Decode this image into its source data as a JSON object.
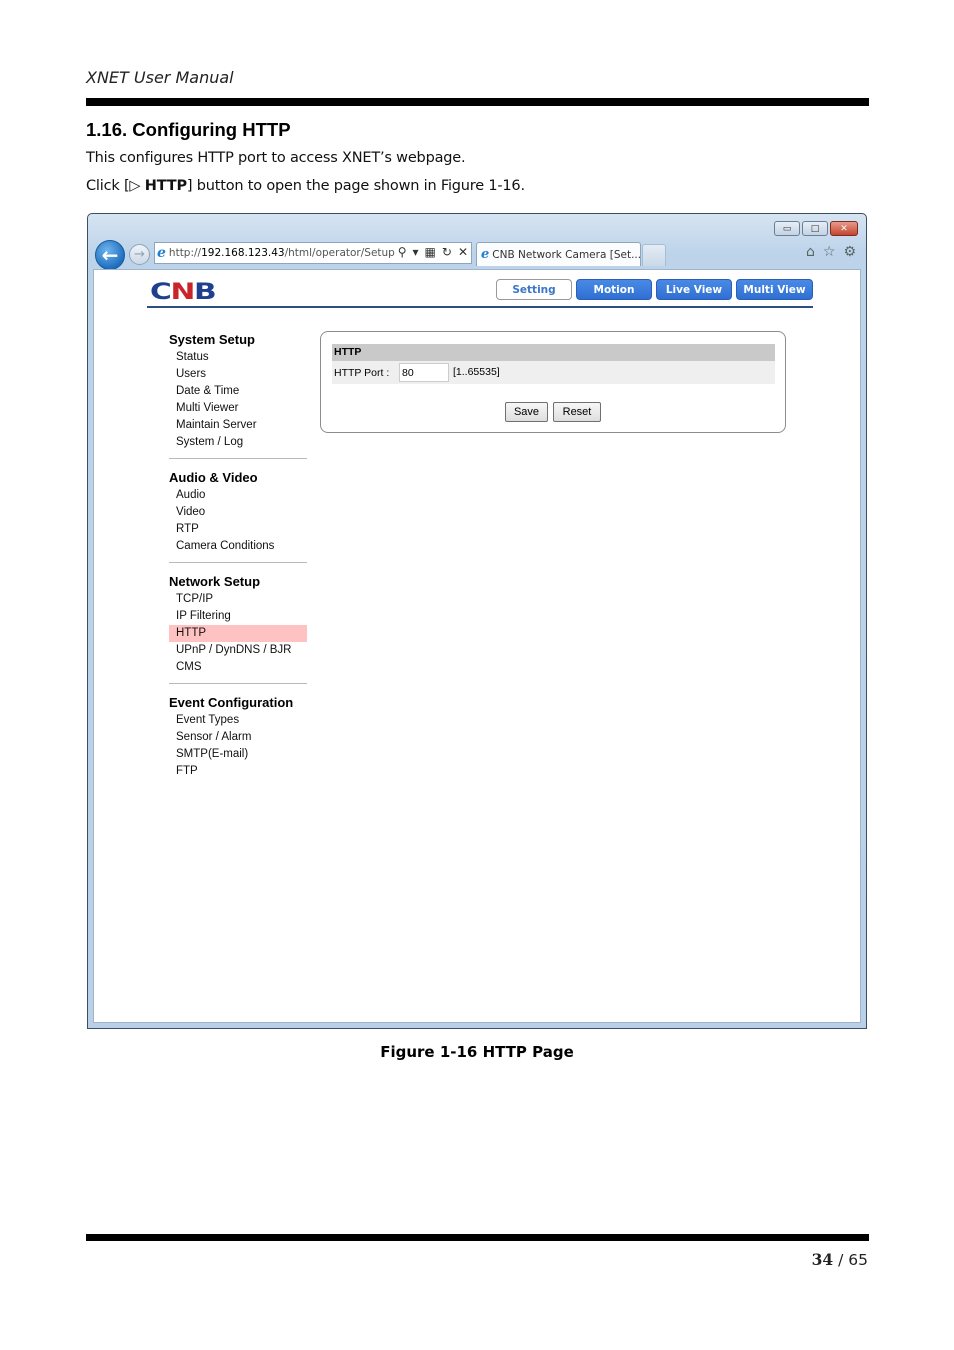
{
  "document": {
    "header": "XNET User Manual",
    "section_title": "1.16. Configuring HTTP",
    "paragraph1": "This configures HTTP port to access XNET’s webpage.",
    "paragraph2_prefix": "Click [",
    "paragraph2_glyph": "▷",
    "paragraph2_bold": "HTTP",
    "paragraph2_suffix": "] button to open the page shown in Figure 1-16.",
    "figure_caption": "Figure 1-16 HTTP Page",
    "page_current": "34",
    "page_separator": "/",
    "page_total": "65"
  },
  "browser": {
    "window_controls": {
      "minimize": "▭",
      "maximize": "□",
      "close": "✕"
    },
    "back_glyph": "←",
    "forward_glyph": "→",
    "ie_glyph": "e",
    "url_scheme": "http://",
    "url_host": "192.168.123.43",
    "url_path": "/html/operator/Setup.html?",
    "address_icons": {
      "search": "⚲",
      "dropdown": "▾",
      "compat": "▦",
      "refresh": "↻",
      "stop": "✕"
    },
    "tab_title": "CNB Network Camera [Set...",
    "tab_close": "✕",
    "tool_icons": {
      "home": "⌂",
      "favorites": "☆",
      "settings": "⚙"
    }
  },
  "app": {
    "logo_c": "C",
    "logo_n": "N",
    "logo_b": "B",
    "top_tabs": [
      {
        "label": "Setting",
        "active": true
      },
      {
        "label": "Motion",
        "active": false
      },
      {
        "label": "Live View",
        "active": false
      },
      {
        "label": "Multi View",
        "active": false
      }
    ],
    "sidebar": [
      {
        "title": "System Setup",
        "items": [
          "Status",
          "Users",
          "Date & Time",
          "Multi Viewer",
          "Maintain Server",
          "System / Log"
        ]
      },
      {
        "title": "Audio & Video",
        "items": [
          "Audio",
          "Video",
          "RTP",
          "Camera Conditions"
        ]
      },
      {
        "title": "Network Setup",
        "items": [
          "TCP/IP",
          "IP Filtering",
          "HTTP",
          "UPnP / DynDNS / BJR",
          "CMS"
        ],
        "active_item": "HTTP"
      },
      {
        "title": "Event Configuration",
        "items": [
          "Event Types",
          "Sensor / Alarm",
          "SMTP(E-mail)",
          "FTP"
        ]
      }
    ],
    "panel": {
      "heading": "HTTP",
      "port_label": "HTTP Port :",
      "port_value": "80",
      "port_range": "[1..65535]",
      "save_label": "Save",
      "reset_label": "Reset"
    },
    "colors": {
      "tab_blue": "#2f6fd2",
      "active_highlight": "#ffc2c2",
      "logo_blue": "#1f3f8f",
      "logo_red": "#c8242a"
    }
  }
}
